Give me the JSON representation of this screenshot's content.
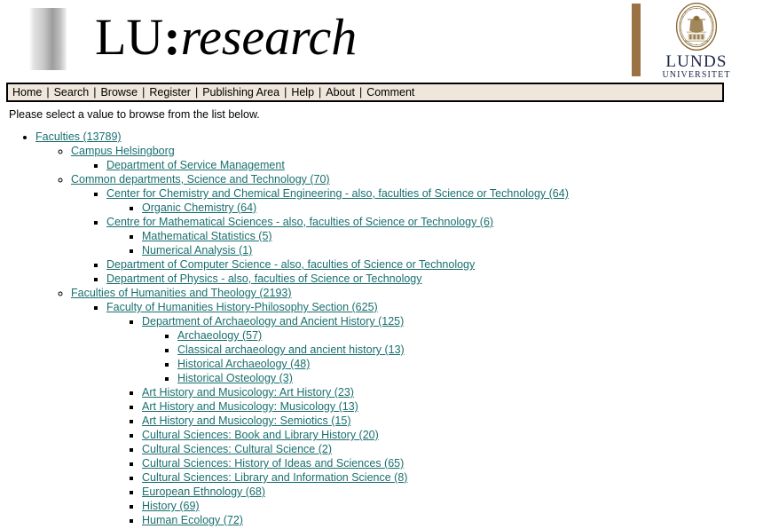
{
  "header": {
    "wordmark": {
      "lu": "LU",
      "colon": ":",
      "research": "research"
    },
    "university": {
      "line1": "LUNDS",
      "line2": "UNIVERSITET"
    },
    "colors": {
      "brand_bar": "#9a7243",
      "seal": "#8a6a33",
      "uni_text": "#1b2348",
      "link": "#1a6f6f",
      "navbar_bg": "#efe7db"
    }
  },
  "nav": {
    "items": [
      {
        "label": "Home"
      },
      {
        "label": "Search"
      },
      {
        "label": "Browse"
      },
      {
        "label": "Register"
      },
      {
        "label": "Publishing Area"
      },
      {
        "label": "Help"
      },
      {
        "label": "About"
      },
      {
        "label": "Comment"
      }
    ],
    "separator": "|"
  },
  "main": {
    "intro": "Please select a value to browse from the list below.",
    "tree": [
      {
        "label": "Faculties (13789)",
        "children": [
          {
            "label": "Campus Helsingborg",
            "children": [
              {
                "label": "Department of Service Management"
              }
            ]
          },
          {
            "label": "Common departments, Science and Technology (70)",
            "children": [
              {
                "label": "Center for Chemistry and Chemical Engineering - also, faculties of Science or Technology (64)",
                "children": [
                  {
                    "label": "Organic Chemistry (64)"
                  }
                ]
              },
              {
                "label": "Centre for Mathematical Sciences - also, faculties of Science or Technology (6)",
                "children": [
                  {
                    "label": "Mathematical Statistics (5)"
                  },
                  {
                    "label": "Numerical Analysis (1)"
                  }
                ]
              },
              {
                "label": "Department of Computer Science - also, faculties of Science or Technology"
              },
              {
                "label": "Department of Physics - also, faculties of Science or Technology"
              }
            ]
          },
          {
            "label": "Faculties of Humanities and Theology (2193)",
            "children": [
              {
                "label": "Faculty of Humanities History-Philosophy Section (625)",
                "children": [
                  {
                    "label": "Department of Archaeology and Ancient History (125)",
                    "children": [
                      {
                        "label": "Archaeology (57)"
                      },
                      {
                        "label": "Classical archaeology and ancient history (13)"
                      },
                      {
                        "label": "Historical Archaeology (48)"
                      },
                      {
                        "label": "Historical Osteology (3)"
                      }
                    ]
                  },
                  {
                    "label": "Art History and Musicology: Art History (23)"
                  },
                  {
                    "label": "Art History and Musicology: Musicology (13)"
                  },
                  {
                    "label": "Art History and Musicology: Semiotics (15)"
                  },
                  {
                    "label": "Cultural Sciences: Book and Library History (20)"
                  },
                  {
                    "label": "Cultural Sciences: Cultural Science (2)"
                  },
                  {
                    "label": "Cultural Sciences: History of Ideas and Sciences (65)"
                  },
                  {
                    "label": "Cultural Sciences: Library and Information Science (8)"
                  },
                  {
                    "label": "European Ethnology (68)"
                  },
                  {
                    "label": "History (69)"
                  },
                  {
                    "label": "Human Ecology (72)"
                  }
                ]
              }
            ]
          }
        ]
      }
    ]
  }
}
